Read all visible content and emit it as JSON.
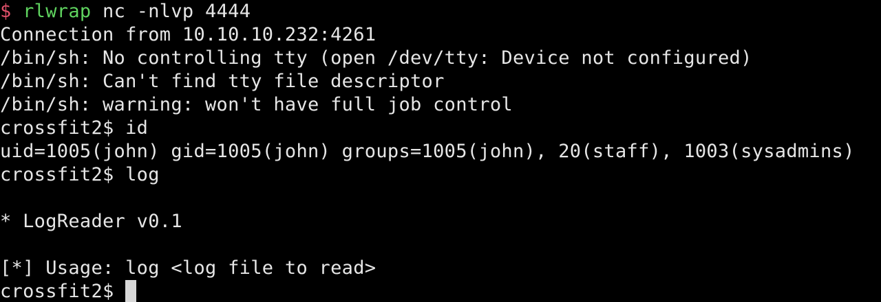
{
  "terminal": {
    "line0": {
      "dollar": "$ ",
      "command": "rlwrap",
      "args": " nc -nlvp 4444"
    },
    "line1": "Connection from 10.10.10.232:4261",
    "line2": "/bin/sh: No controlling tty (open /dev/tty: Device not configured)",
    "line3": "/bin/sh: Can't find tty file descriptor",
    "line4": "/bin/sh: warning: won't have full job control",
    "line5": "crossfit2$ id",
    "line6": "uid=1005(john) gid=1005(john) groups=1005(john), 20(staff), 1003(sysadmins)",
    "line7": "crossfit2$ log",
    "line8": "",
    "line9": "* LogReader v0.1",
    "line10": "",
    "line11": "[*] Usage: log <log file to read>",
    "line12": "crossfit2$ "
  },
  "colors": {
    "background": "#000000",
    "text": "#e6e6e6",
    "dollar": "#e0506a",
    "command": "#5fd35f",
    "cursor": "#d8d8d8"
  }
}
